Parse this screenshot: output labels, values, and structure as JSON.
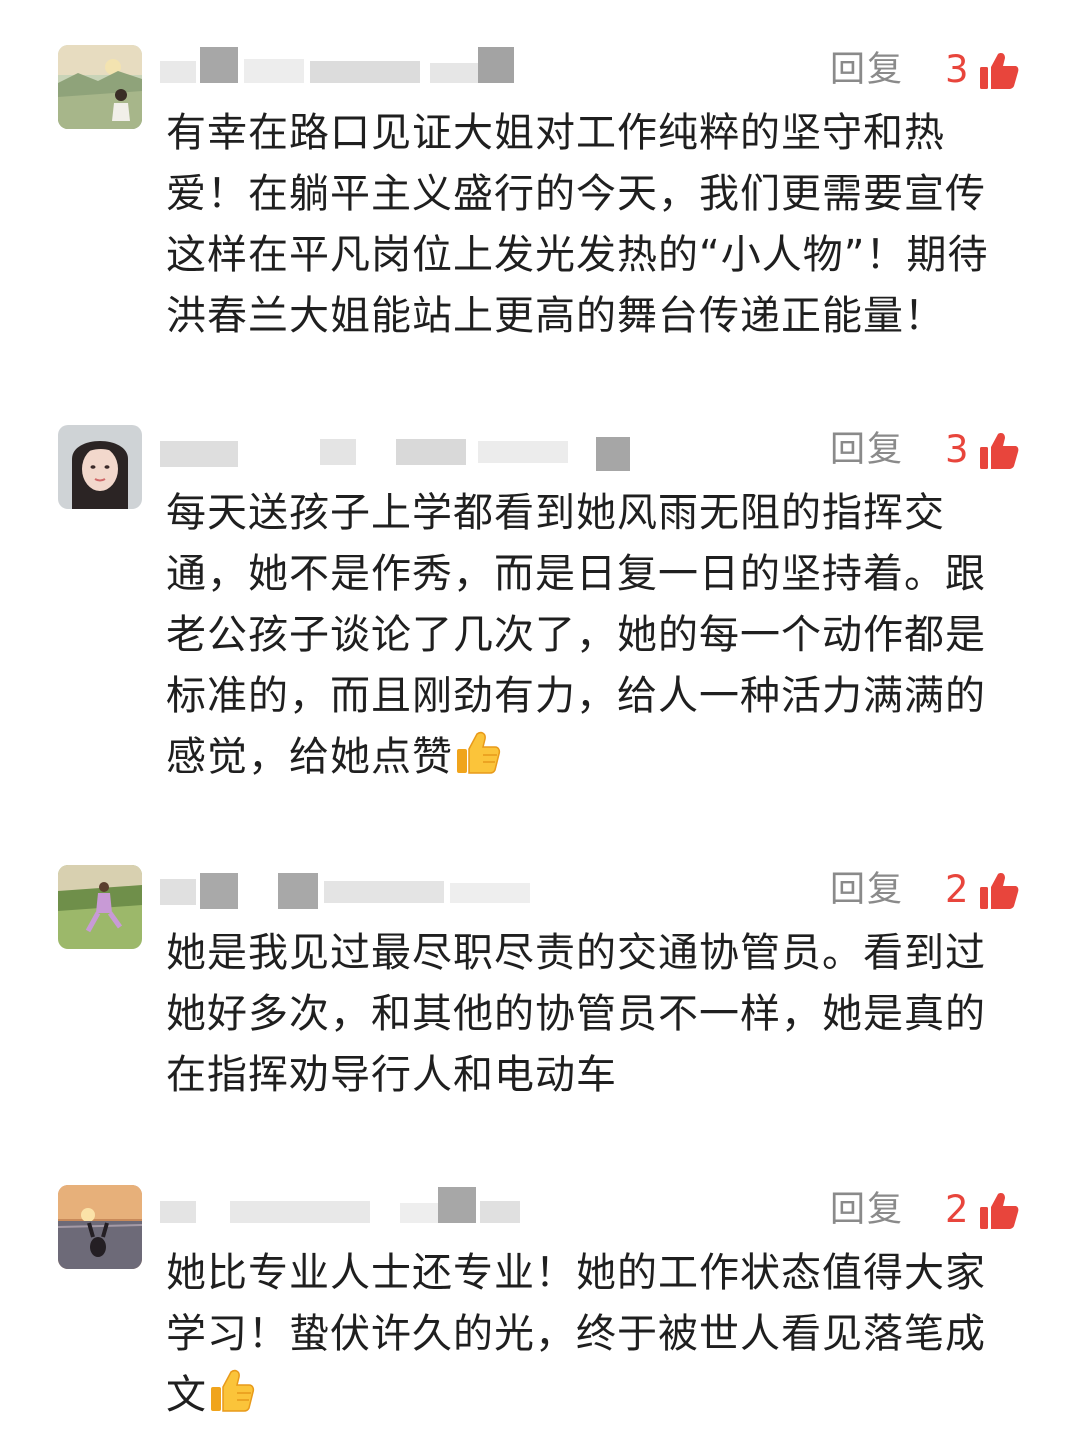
{
  "comments": [
    {
      "reply_label": "回复",
      "likes": "3",
      "text": "有幸在路口见证大姐对工作纯粹的坚守和热\n爱！在躺平主义盛行的今天，我们更需要宣传\n这样在平凡岗位上发光发热的“小人物”！期待\n洪春兰大姐能站上更高的舞台传递正能量！",
      "has_emoji": false
    },
    {
      "reply_label": "回复",
      "likes": "3",
      "text": "每天送孩子上学都看到她风雨无阻的指挥交\n通，她不是作秀，而是日复一日的坚持着。跟\n老公孩子谈论了几次了，她的每一个动作都是\n标准的，而且刚劲有力，给人一种活力满满的\n感觉，给她点赞",
      "has_emoji": true,
      "emoji": "thumbs-up-emoji"
    },
    {
      "reply_label": "回复",
      "likes": "2",
      "text": "她是我见过最尽职尽责的交通协管员。看到过\n她好多次，和其他的协管员不一样，她是真的\n在指挥劝导行人和电动车",
      "has_emoji": false
    },
    {
      "reply_label": "回复",
      "likes": "2",
      "text": "她比专业人士还专业！她的工作状态值得大家\n学习！蛰伏许久的光，终于被世人看见落笔成\n文",
      "has_emoji": true,
      "emoji": "thumbs-up-emoji"
    }
  ],
  "colors": {
    "reply": "#8a8a8a",
    "likes": "#e8453c",
    "text": "#1f1f1f"
  }
}
